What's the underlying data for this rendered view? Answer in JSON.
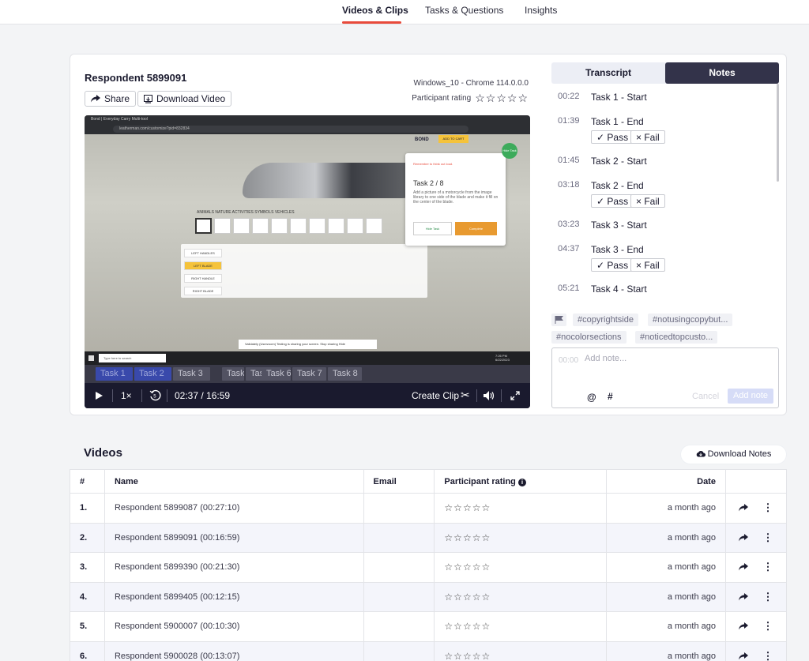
{
  "nav": {
    "tabs": [
      "Videos & Clips",
      "Tasks & Questions",
      "Insights"
    ],
    "active": 0
  },
  "respondent": {
    "title": "Respondent 5899091",
    "share": "Share",
    "download_video": "Download Video",
    "system": "Windows_10 - Chrome 114.0.0.0",
    "rating_label": "Participant rating",
    "rating_stars": "☆☆☆☆☆"
  },
  "player": {
    "browser_tab": "Bond | Everyday Carry Multi-tool",
    "url": "leatherman.com/customize?pid=832834",
    "categories": "ANIMALS  NATURE  ACTIVITIES  SYMBOLS  VEHICLES",
    "options": [
      "LEFT HANDLES",
      "LEFT BLADE",
      "RIGHT HANDLE",
      "RIGHT BLADE"
    ],
    "popup_think": "Remember to think out loud.",
    "popup_task": "Task 2 / 8",
    "popup_desc": "Add a picture of a motorcycle from the image library to one side of the blade and make it fill on the center of the blade.",
    "popup_hide": "Hide Task",
    "popup_complete": "Complete",
    "hide_circle": "Hide Task",
    "bond_label": "BOND",
    "add_to_cart": "ADD TO CART",
    "sharing_text": "Validately (Userzoom) Testing is sharing your screen.  Stop sharing  Hide",
    "taskbar_search": "Type here to search",
    "clock": "7:26 PM\n6/22/2023",
    "task_segments": [
      "Task 1",
      "Task 2",
      "Task 3",
      "Task",
      "Tasi",
      "Task 6",
      "Task 7",
      "Task 8"
    ],
    "speed": "1×",
    "time": "02:37 / 16:59",
    "create_clip": "Create Clip"
  },
  "right_panel": {
    "tabs": [
      "Transcript",
      "Notes"
    ],
    "active": 1,
    "notes": [
      {
        "t": "00:22",
        "text": "Task 1 - Start"
      },
      {
        "t": "01:39",
        "text": "Task 1 - End",
        "pf": true
      },
      {
        "t": "01:45",
        "text": "Task 2 - Start"
      },
      {
        "t": "03:18",
        "text": "Task 2 - End",
        "pf": true
      },
      {
        "t": "03:23",
        "text": "Task 3 - Start"
      },
      {
        "t": "04:37",
        "text": "Task 3 - End",
        "pf": true
      },
      {
        "t": "05:21",
        "text": "Task 4 - Start"
      }
    ],
    "pass": "Pass",
    "fail": "Fail",
    "tags": [
      "#copyrightside",
      "#notusingcopybut...",
      "#nocolorsections",
      "#noticedtopcusto..."
    ],
    "note_ts": "00:00",
    "note_placeholder": "Add note...",
    "at": "@",
    "hash": "#",
    "cancel": "Cancel",
    "add_note": "Add note"
  },
  "videos": {
    "title": "Videos",
    "download_notes": "Download Notes",
    "headers": [
      "#",
      "Name",
      "Email",
      "Participant rating",
      "Date"
    ],
    "rows": [
      {
        "num": "1.",
        "name": "Respondent 5899087 (00:27:10)",
        "email": "",
        "rating": "☆☆☆☆☆",
        "date": "a month ago"
      },
      {
        "num": "2.",
        "name": "Respondent 5899091 (00:16:59)",
        "email": "",
        "rating": "☆☆☆☆☆",
        "date": "a month ago"
      },
      {
        "num": "3.",
        "name": "Respondent 5899390 (00:21:30)",
        "email": "",
        "rating": "☆☆☆☆☆",
        "date": "a month ago"
      },
      {
        "num": "4.",
        "name": "Respondent 5899405 (00:12:15)",
        "email": "",
        "rating": "☆☆☆☆☆",
        "date": "a month ago"
      },
      {
        "num": "5.",
        "name": "Respondent 5900007 (00:10:30)",
        "email": "",
        "rating": "☆☆☆☆☆",
        "date": "a month ago"
      },
      {
        "num": "6.",
        "name": "Respondent 5900028 (00:13:07)",
        "email": "",
        "rating": "☆☆☆☆☆",
        "date": "a month ago"
      }
    ]
  },
  "colors": {
    "accent": "#e84a3b",
    "dark_tab": "#33334a",
    "task_done": "#3949ab"
  }
}
